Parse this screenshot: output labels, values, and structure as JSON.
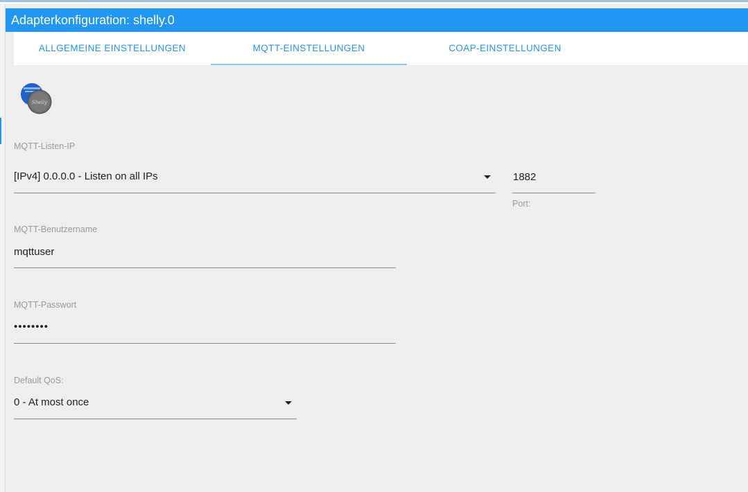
{
  "window": {
    "title": "Adapterkonfiguration: shelly.0"
  },
  "tabs": [
    {
      "label": "ALLGEMEINE EINSTELLUNGEN",
      "active": false
    },
    {
      "label": "MQTT-EINSTELLUNGEN",
      "active": true
    },
    {
      "label": "COAP-EINSTELLUNGEN",
      "active": false
    }
  ],
  "logo": {
    "icon": "shelly-logo-icon"
  },
  "form": {
    "listen_ip": {
      "label": "MQTT-Listen-IP",
      "value": "[IPv4] 0.0.0.0 - Listen on all IPs"
    },
    "port": {
      "label": "Port:",
      "value": "1882"
    },
    "username": {
      "label": "MQTT-Benutzername",
      "value": "mqttuser"
    },
    "password": {
      "label": "MQTT-Passwort",
      "value": "••••••••"
    },
    "qos": {
      "label": "Default QoS:",
      "value": "0 - At most once"
    }
  },
  "colors": {
    "accent": "#2196f3",
    "background": "#eeeeee"
  }
}
